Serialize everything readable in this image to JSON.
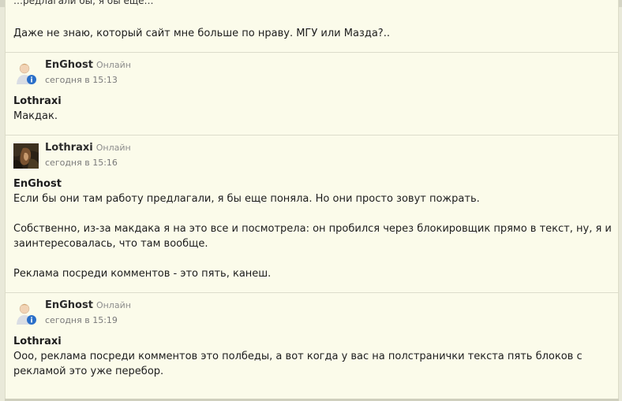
{
  "top_comment": {
    "cut_text": "…редлагали бы, я бы ещё…",
    "text": "Даже не знаю, который сайт мне больше по нраву. МГУ или Мазда?.."
  },
  "comments": [
    {
      "author": "EnGhost",
      "status": "Онлайн",
      "date": "сегодня в 15:13",
      "quote_name": "Lothraxi",
      "paragraphs": [
        "Макдак."
      ]
    },
    {
      "author": "Lothraxi",
      "status": "Онлайн",
      "date": "сегодня в 15:16",
      "quote_name": "EnGhost",
      "paragraphs": [
        "Если бы они там работу предлагали, я бы еще поняла. Но они просто зовут пожрать.",
        "Собственно, из-за макдака я на это все и посмотрела: он пробился через блокировщик прямо в текст, ну, я и заинтересовалась, что там вообще.",
        "Реклама посреди комментов - это пять, канеш."
      ]
    },
    {
      "author": "EnGhost",
      "status": "Онлайн",
      "date": "сегодня в 15:19",
      "quote_name": "Lothraxi",
      "paragraphs": [
        "Ооо, реклама посреди комментов это полбеды, а вот когда у вас на полстранички текста пять блоков с рекламой это уже перебор."
      ]
    }
  ],
  "colors": {
    "panel_bg": "#fbfbea",
    "status_gray": "#8c8c8c",
    "info_badge": "#2a6fc9"
  }
}
